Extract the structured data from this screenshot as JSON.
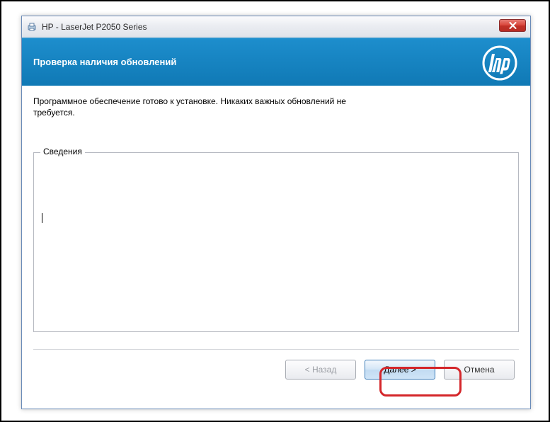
{
  "window": {
    "title": "HP - LaserJet P2050 Series"
  },
  "banner": {
    "title": "Проверка наличия обновлений",
    "logo_text": "hp"
  },
  "body": {
    "status_line1": "Программное обеспечение готово к установке. Никаких важных обновлений не",
    "status_line2": "требуется.",
    "details_legend": "Сведения",
    "details_content": ""
  },
  "buttons": {
    "back": "< Назад",
    "next": "Далее >",
    "cancel": "Отмена"
  }
}
